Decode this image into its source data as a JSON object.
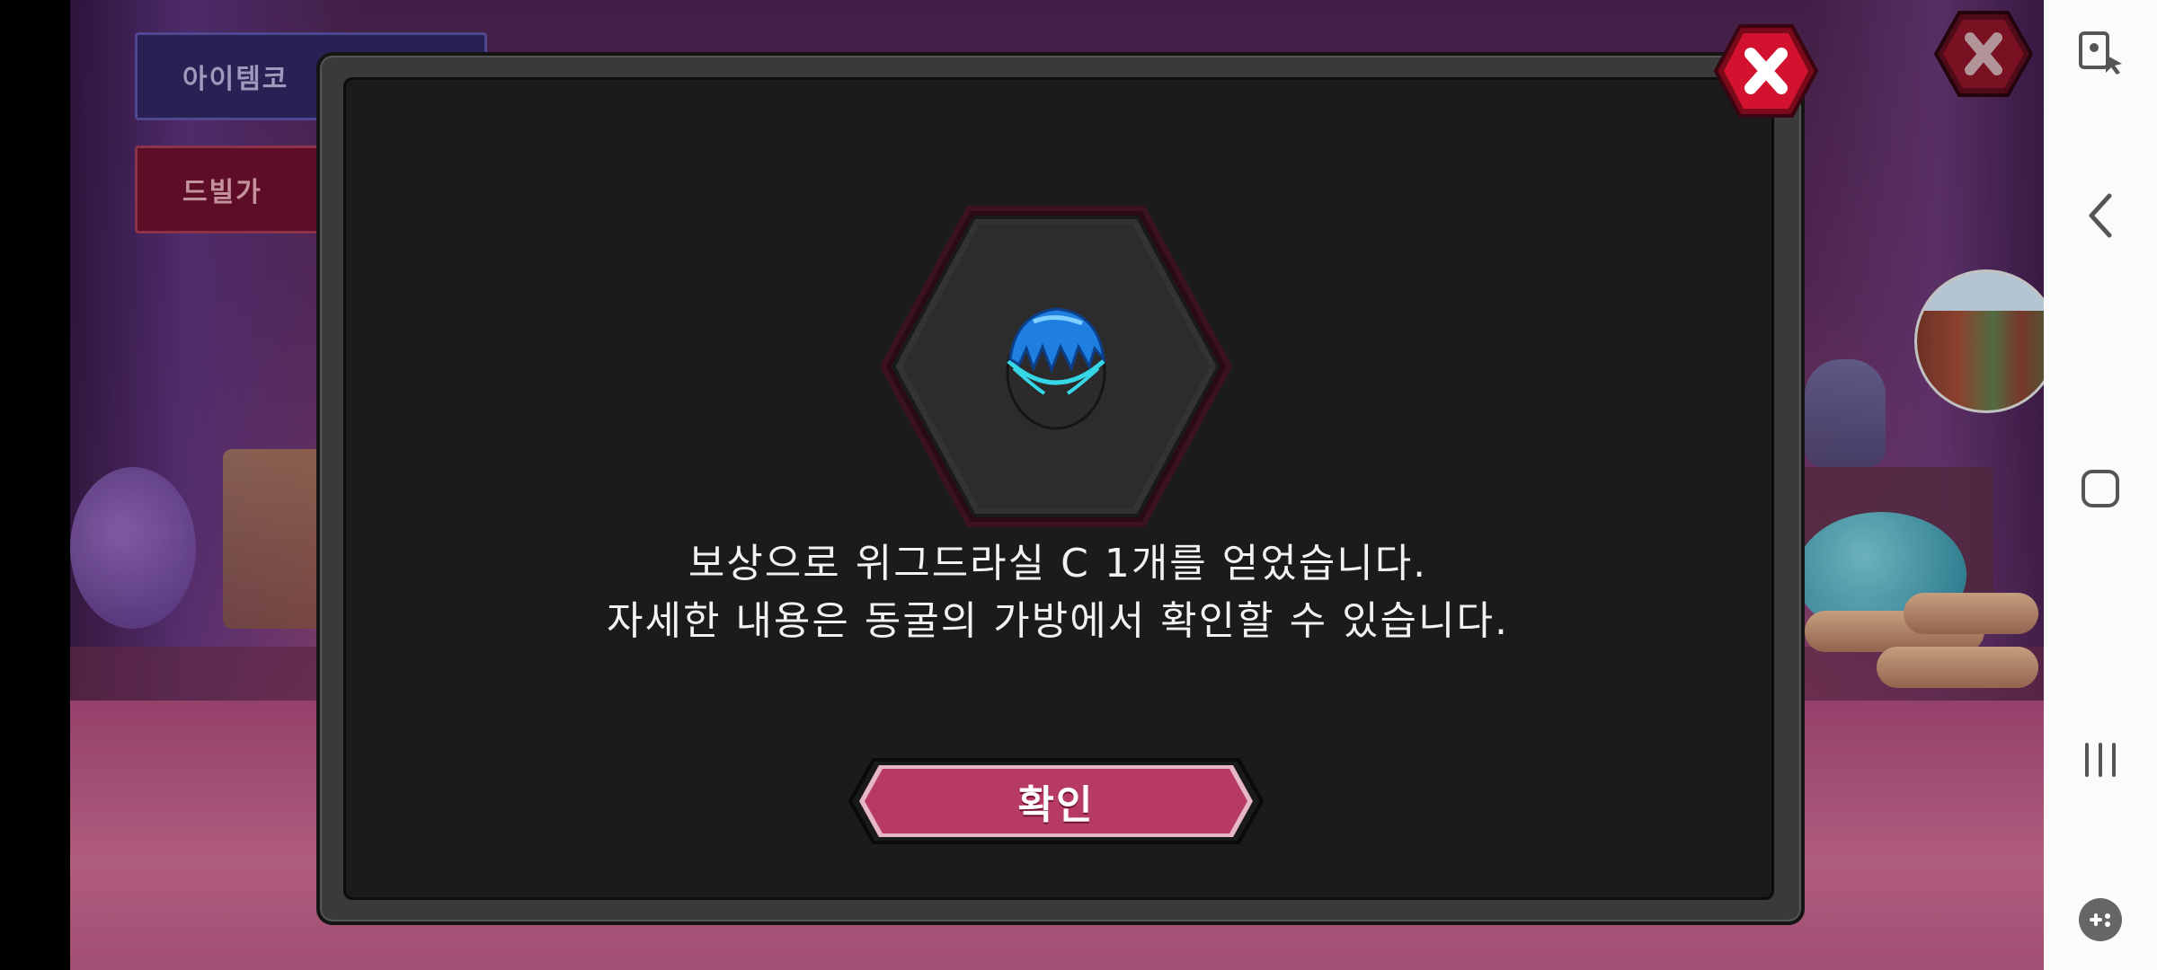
{
  "game_menu": {
    "item_code_label": "아이템코",
    "devil_label": "드빌가"
  },
  "reward_dialog": {
    "item_icon": "blue-hair-egg-icon",
    "message_line1": "보상으로 위그드라실 C 1개를 얻었습니다.",
    "message_line2": "자세한 내용은 동굴의 가방에서 확인할 수 있습니다.",
    "confirm_label": "확인",
    "close_icon": "close-x-icon"
  },
  "system_nav": {
    "items": [
      "screen-pin-icon",
      "back-icon",
      "home-icon",
      "recent-apps-icon",
      "game-launcher-icon"
    ]
  },
  "colors": {
    "dialog_bg": "#1b1b1b",
    "dialog_frame": "#3a3a3a",
    "confirm_button": "#b73a65",
    "close_button": "#c8102e",
    "hex_border": "#3a1220"
  }
}
